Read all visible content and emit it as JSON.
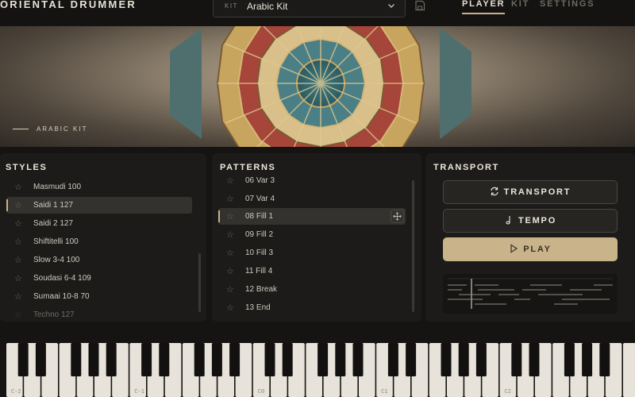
{
  "header": {
    "brand": "ORIENTAL DRUMMER",
    "kit_label": "KIT",
    "kit_value": "Arabic Kit",
    "tabs": [
      {
        "label": "PLAYER",
        "active": true
      },
      {
        "label": "KIT",
        "active": false
      },
      {
        "label": "SETTINGS",
        "active": false
      }
    ]
  },
  "banner": {
    "label": "ARABIC KIT"
  },
  "styles": {
    "title": "STYLES",
    "items": [
      {
        "label": "Masmudi 100"
      },
      {
        "label": "Saidi 1 127",
        "selected": true
      },
      {
        "label": "Saidi 2 127"
      },
      {
        "label": "Shiftitelli 100"
      },
      {
        "label": "Slow 3-4 100"
      },
      {
        "label": "Soudasi 6-4 109"
      },
      {
        "label": "Sumaai 10-8 70"
      },
      {
        "label": "Techno 127"
      }
    ]
  },
  "patterns": {
    "title": "PATTERNS",
    "items": [
      {
        "label": "06 Var 3"
      },
      {
        "label": "07 Var 4"
      },
      {
        "label": "08 Fill 1",
        "selected": true
      },
      {
        "label": "09 Fill 2"
      },
      {
        "label": "10 Fill 3"
      },
      {
        "label": "11 Fill 4"
      },
      {
        "label": "12 Break"
      },
      {
        "label": "13 End"
      }
    ]
  },
  "transport": {
    "title": "TRANSPORT",
    "transport_label": "TRANSPORT",
    "tempo_label": "TEMPO",
    "play_label": "PLAY"
  },
  "piano": {
    "octave_labels": [
      "C-2",
      "C-1",
      "C0",
      "C1",
      "C2"
    ]
  },
  "colors": {
    "accent": "#c9b38b",
    "panel": "#1c1b19",
    "background": "#151412"
  }
}
